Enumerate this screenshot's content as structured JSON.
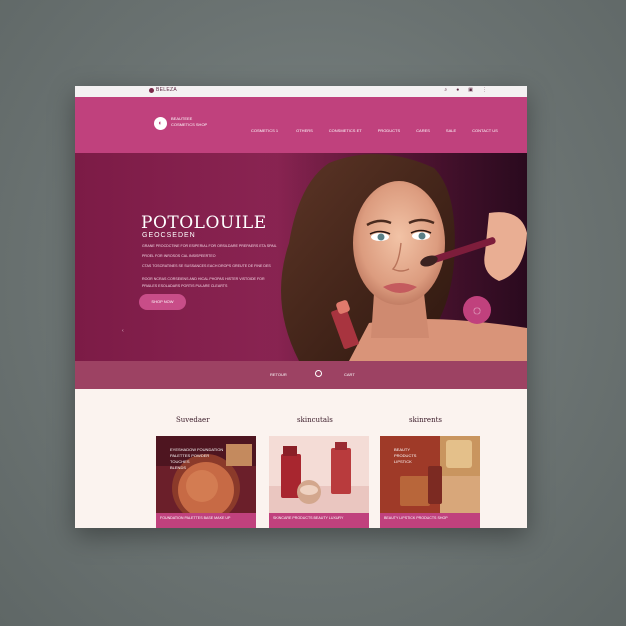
{
  "utility_bar": {
    "brand": "BELEZA",
    "icons": [
      "search-icon",
      "user-icon",
      "cart-icon",
      "menu-icon"
    ]
  },
  "header": {
    "logo_mark": "◐",
    "logo_line1": "BEAUTEEE",
    "logo_line2": "COSMETICS SHOP",
    "nav": [
      "COSMETICS 1",
      "OTHERS",
      "CONSMETICS ET",
      "PRODUCTS",
      "CARES",
      "SALE",
      "CONTACT US"
    ]
  },
  "hero": {
    "title": "POTOLOUILE",
    "subtitle": "GEOCSEDEN",
    "lines": [
      "GRANE PROCDCTINE FOR ESIPERIAL FOR ORSILDARE PREPAERS ETA SPAIL",
      "PROEL FOR INROSOS CAL INSISPEERTEO",
      "CTAS TOSCRATINES SE SUSSANCES EACH DROPS GREUTE DE FINE DES",
      "ROOR NCRAS CORSEIENS AND HICAL PHOPAS HISTER VISTOIDE FOR",
      "PRAILES ESOLADARS PORTIS PULARE CLEARTS"
    ],
    "cta": "SHOP NOW",
    "badge_icon": "play-icon"
  },
  "strip": {
    "label1": "RETOUR",
    "label2": "CART"
  },
  "categories": [
    {
      "heading": "Suvedaer",
      "overlay": "EYESHADOW FOUNDATION\nPALETTES POWDER\nTOUCHES\nBLENDS",
      "footer": "FOUNDATION PALETTES BASE MAKE UP",
      "palette": "eyeshadow"
    },
    {
      "heading": "skincutals",
      "overlay": "",
      "footer": "SKINCARE PRODUCTS BEAUTY LUXURY",
      "palette": "perfume"
    },
    {
      "heading": "skinrents",
      "overlay": "BEAUTY\nPRODUCTS\nLIPSTICK",
      "footer": "BEAUTY LIPSTICK PRODUCTS SHOP",
      "palette": "lipstick"
    }
  ],
  "colors": {
    "brand_pink": "#c0417d",
    "hero_dark": "#7c1b46",
    "strip": "#9d4263",
    "page_bg": "#fbf3ef"
  }
}
